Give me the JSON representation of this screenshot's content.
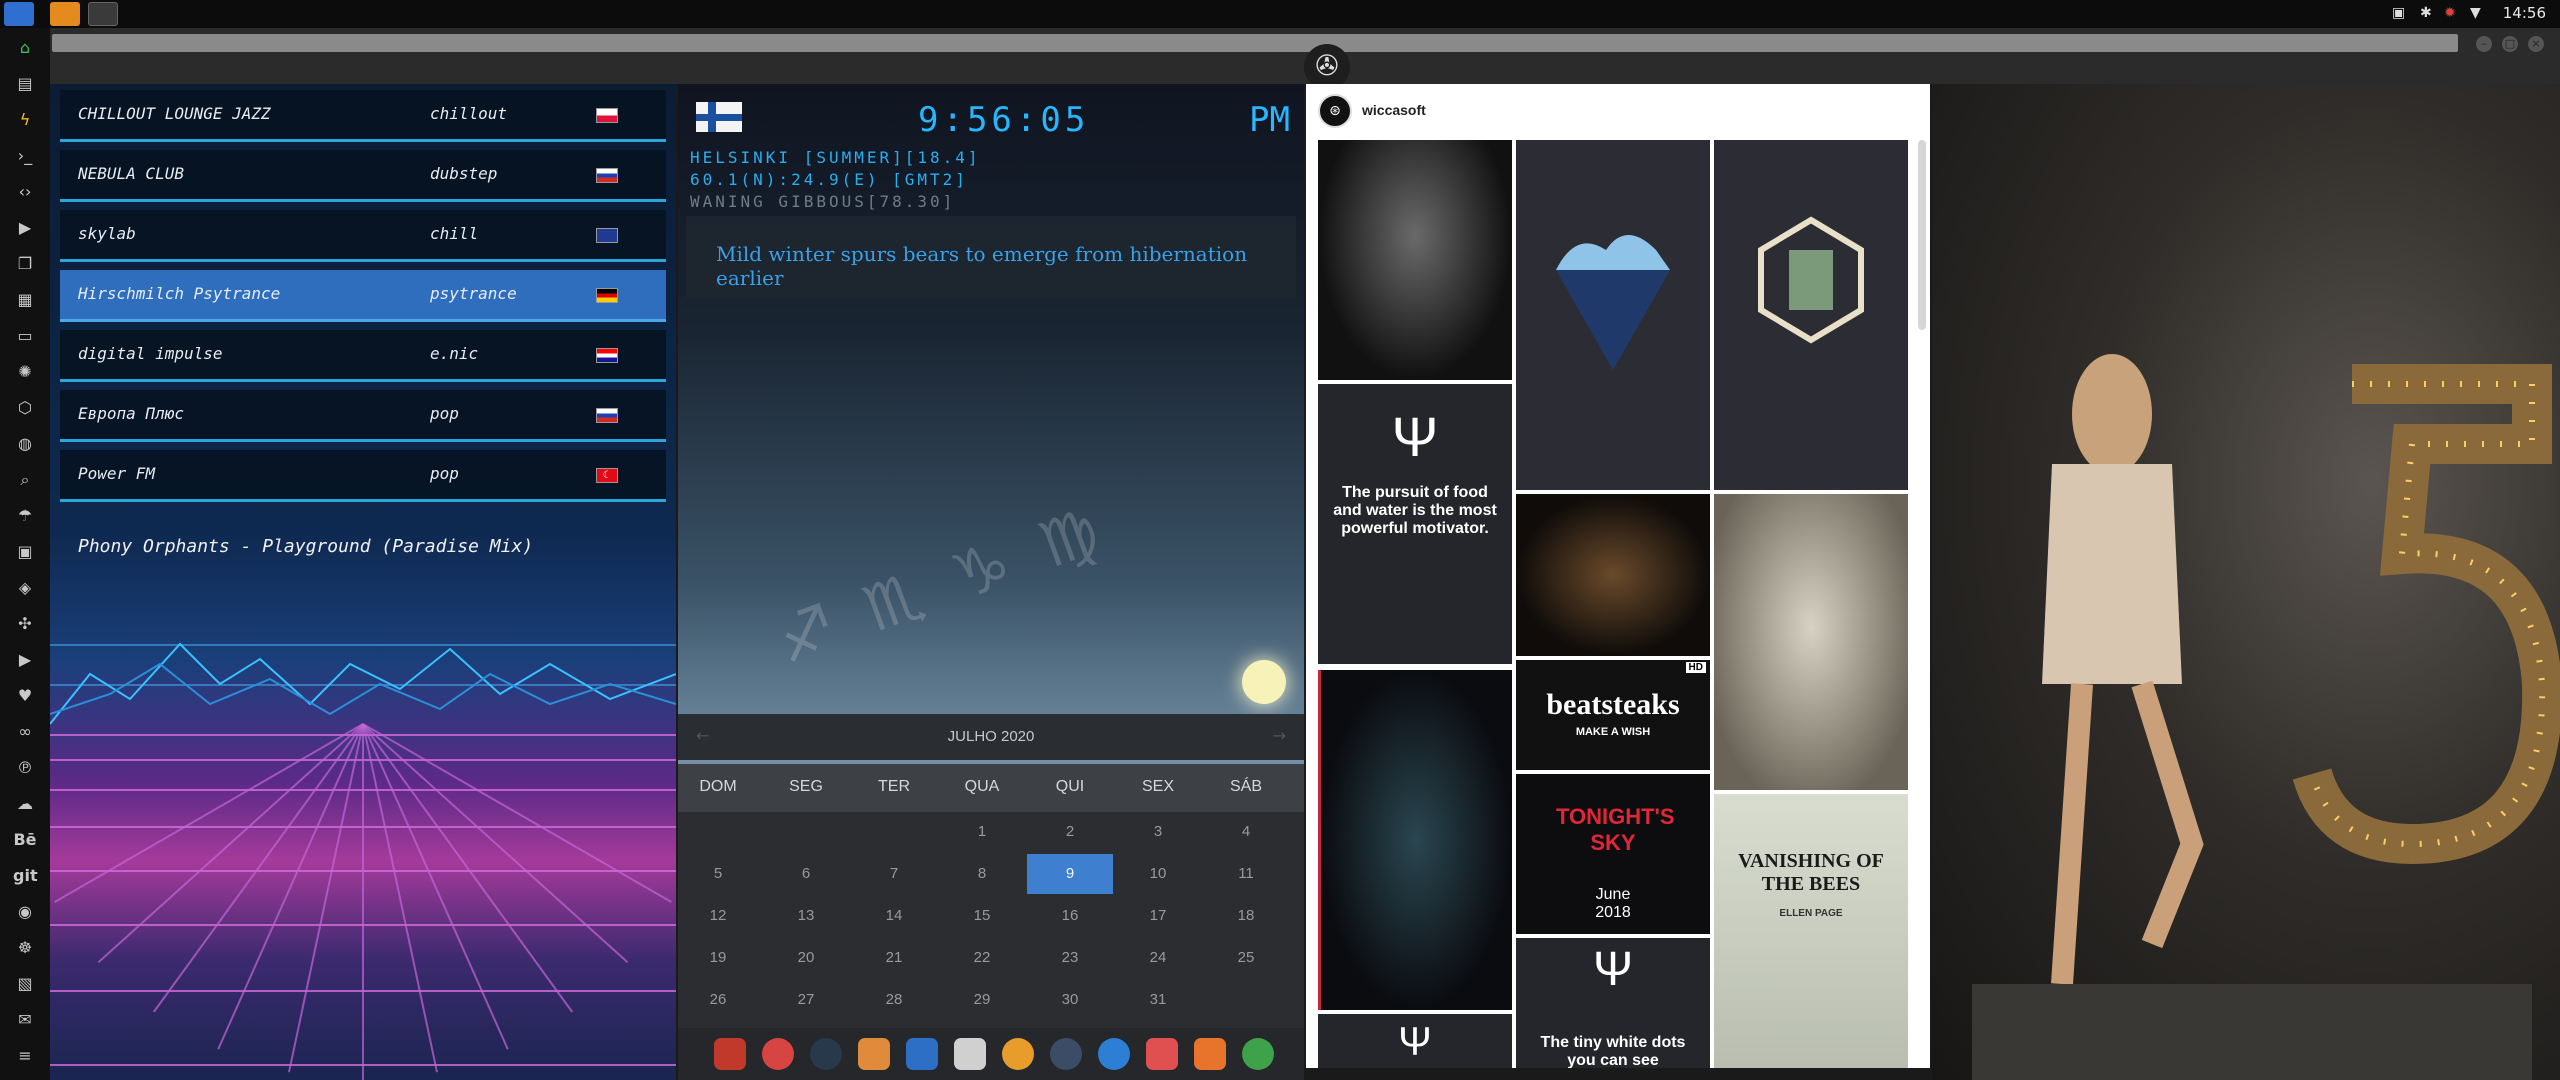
{
  "system_bar": {
    "clock": "14:56"
  },
  "radio": {
    "stations": [
      {
        "name": "CHILLOUT LOUNGE JAZZ",
        "genre": "chillout",
        "flag": "poland-flag"
      },
      {
        "name": "NEBULA CLUB",
        "genre": "dubstep",
        "flag": "russia-flag"
      },
      {
        "name": "skylab",
        "genre": "chill",
        "flag": "uk-flag"
      },
      {
        "name": "Hirschmilch Psytrance",
        "genre": "psytrance",
        "flag": "germany-flag",
        "selected": true
      },
      {
        "name": "digital impulse",
        "genre": "e.nic",
        "flag": "croatia-flag"
      },
      {
        "name": "Европа Плюс",
        "genre": "pop",
        "flag": "russia-flag"
      },
      {
        "name": "Power FM",
        "genre": "pop",
        "flag": "turkey-flag"
      }
    ],
    "now_playing": "Phony Orphants - Playground (Paradise Mix)"
  },
  "clock_panel": {
    "time": "9:56:05",
    "ampm": "PM",
    "location_line": "HELSINKI [SUMMER][18.4]",
    "coords_line": "60.1(N):24.9(E) [GMT2]",
    "moon_line": "WANING GIBBOUS[78.30]",
    "news_headline": "Mild winter spurs bears to emerge from hibernation earlier"
  },
  "calendar": {
    "title": "JULHO 2020",
    "day_names": [
      "DOM",
      "SEG",
      "TER",
      "QUA",
      "QUI",
      "SEX",
      "SÁB"
    ],
    "weeks": [
      [
        "",
        "",
        "",
        "1",
        "2",
        "3",
        "4"
      ],
      [
        "5",
        "6",
        "7",
        "8",
        "9",
        "10",
        "11"
      ],
      [
        "12",
        "13",
        "14",
        "15",
        "16",
        "17",
        "18"
      ],
      [
        "19",
        "20",
        "21",
        "22",
        "23",
        "24",
        "25"
      ],
      [
        "26",
        "27",
        "28",
        "29",
        "30",
        "31",
        ""
      ]
    ],
    "today": "9"
  },
  "instagram": {
    "username": "wiccasoft",
    "posts": {
      "pursuit_text": "The pursuit of food and water is the most powerful motivator.",
      "beatsteaks_title": "beatsteaks",
      "beatsteaks_sub": "MAKE A WISH",
      "hd_badge": "HD",
      "tonight_title": "TONIGHT'S SKY",
      "tonight_date": "June 2018",
      "vanishing_title": "VANISHING OF THE BEES",
      "vanishing_narrator": "ELLEN PAGE",
      "tiny_dots_text": "The tiny white dots you can see"
    }
  },
  "colors": {
    "accent_blue": "#27b7ff",
    "selected_station": "#2f6ebd",
    "today_highlight": "#3f7fd0"
  }
}
